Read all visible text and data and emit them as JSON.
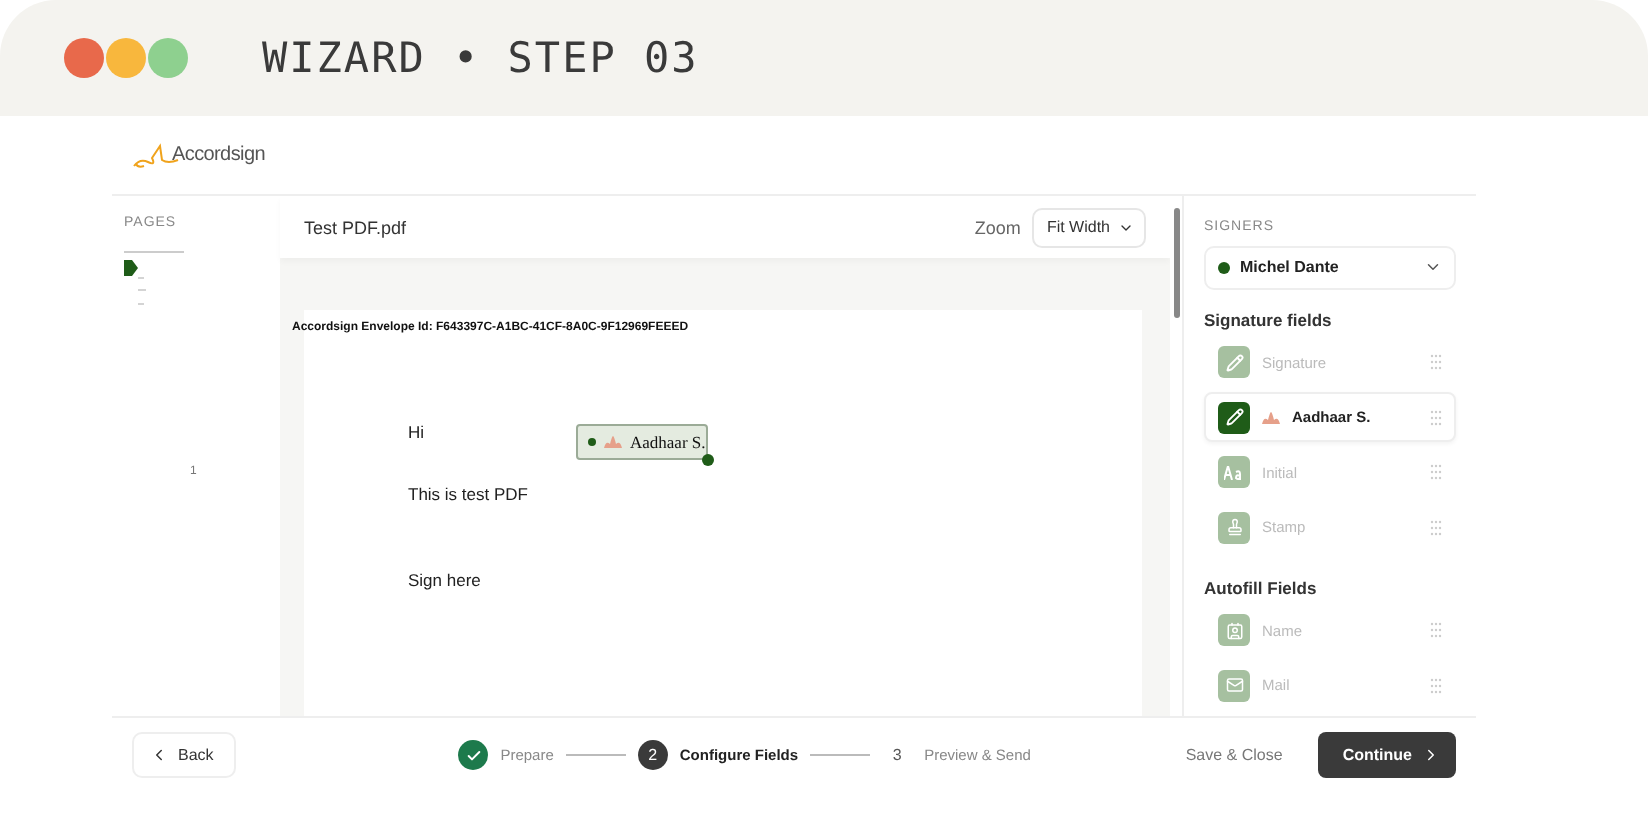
{
  "header": {
    "title": "WIZARD • STEP 03"
  },
  "logo": {
    "text": "Accordsign"
  },
  "pages": {
    "label": "PAGES",
    "page_number": "1"
  },
  "document": {
    "file_name": "Test PDF.pdf",
    "zoom_label": "Zoom",
    "zoom_value": "Fit Width",
    "envelope_id": "Accordsign Envelope Id: F643397C-A1BC-41CF-8A0C-9F12969FEEED",
    "lines": [
      "Hi",
      "This is test PDF",
      "Sign here"
    ],
    "placed_field": "Aadhaar S."
  },
  "sidebar": {
    "signers_label": "SIGNERS",
    "signer": {
      "name": "Michel Dante",
      "color": "#1f5c18"
    },
    "sections": [
      {
        "title": "Signature fields",
        "items": [
          {
            "label": "Signature",
            "kind": "pen",
            "selected": false
          },
          {
            "label": "Aadhaar S.",
            "kind": "pen",
            "selected": true
          },
          {
            "label": "Initial",
            "kind": "text",
            "selected": false
          },
          {
            "label": "Stamp",
            "kind": "stamp",
            "selected": false
          }
        ]
      },
      {
        "title": "Autofill Fields",
        "items": [
          {
            "label": "Name",
            "kind": "contact",
            "selected": false
          },
          {
            "label": "Mail",
            "kind": "mail",
            "selected": false
          }
        ]
      }
    ]
  },
  "footer": {
    "back": "Back",
    "steps": [
      {
        "completed": true,
        "selected": false,
        "label": "Prepare"
      },
      {
        "completed": false,
        "selected": true,
        "number": "2",
        "label": "Configure Fields"
      },
      {
        "completed": false,
        "selected": false,
        "number": "3",
        "label": "Preview & Send"
      }
    ],
    "save": "Save & Close",
    "continue": "Continue"
  }
}
